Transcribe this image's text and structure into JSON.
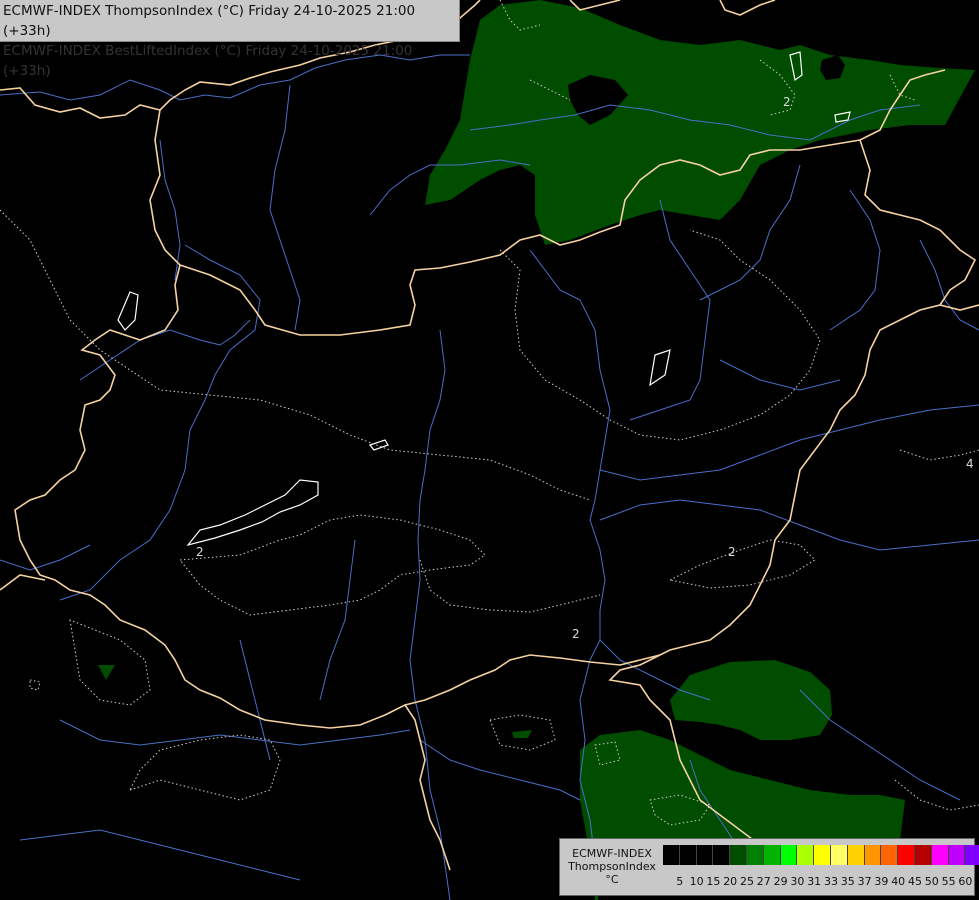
{
  "header": {
    "line1": "ECMWF-INDEX ThompsonIndex (°C) Friday 24-10-2025 21:00 (+33h)",
    "line2": "ECMWF-INDEX BestLiftedIndex (°C) Friday 24-10-2025 21:00 (+33h)"
  },
  "legend": {
    "model": "ECMWF-INDEX",
    "parameter": "ThompsonIndex",
    "unit": "°C",
    "ticks": [
      "5",
      "10",
      "15",
      "20",
      "25",
      "27",
      "29",
      "30",
      "31",
      "33",
      "35",
      "37",
      "39",
      "40",
      "45",
      "50",
      "55",
      "60"
    ],
    "colors": [
      "#000000",
      "#000000",
      "#000000",
      "#000000",
      "#004d00",
      "#008000",
      "#00b400",
      "#00ff00",
      "#aaff00",
      "#ffff00",
      "#ffff66",
      "#ffd200",
      "#ff9600",
      "#ff6400",
      "#ff0000",
      "#b40000",
      "#ff00ff",
      "#c000ff",
      "#8000ff",
      "#0000ff"
    ]
  },
  "map": {
    "contour_labels": [
      "2",
      "2",
      "2",
      "2",
      "4"
    ],
    "colors": {
      "background": "#000000",
      "thompson_fill": "#004d00",
      "borders": "#f5d2a0",
      "rivers": "#4a6fc8",
      "contours": "#cfcfcf",
      "lakes": "#ffffff"
    }
  }
}
